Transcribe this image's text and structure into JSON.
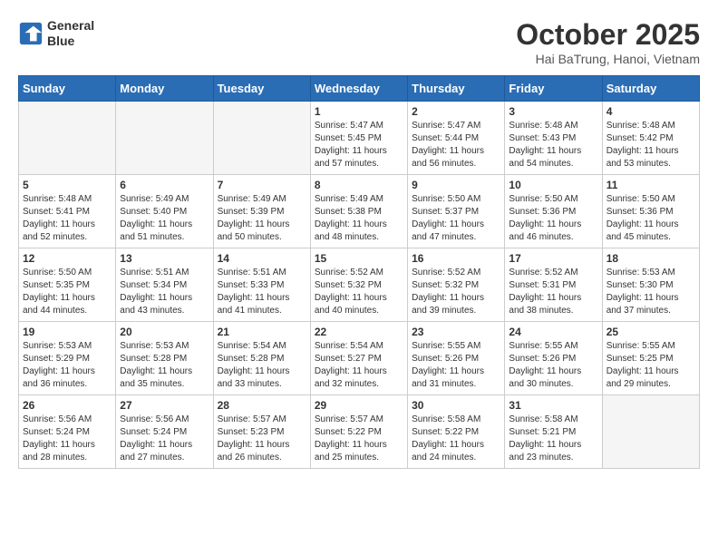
{
  "header": {
    "logo_line1": "General",
    "logo_line2": "Blue",
    "title": "October 2025",
    "subtitle": "Hai BaTrung, Hanoi, Vietnam"
  },
  "calendar": {
    "weekdays": [
      "Sunday",
      "Monday",
      "Tuesday",
      "Wednesday",
      "Thursday",
      "Friday",
      "Saturday"
    ],
    "weeks": [
      [
        {
          "day": "",
          "info": ""
        },
        {
          "day": "",
          "info": ""
        },
        {
          "day": "",
          "info": ""
        },
        {
          "day": "1",
          "info": "Sunrise: 5:47 AM\nSunset: 5:45 PM\nDaylight: 11 hours\nand 57 minutes."
        },
        {
          "day": "2",
          "info": "Sunrise: 5:47 AM\nSunset: 5:44 PM\nDaylight: 11 hours\nand 56 minutes."
        },
        {
          "day": "3",
          "info": "Sunrise: 5:48 AM\nSunset: 5:43 PM\nDaylight: 11 hours\nand 54 minutes."
        },
        {
          "day": "4",
          "info": "Sunrise: 5:48 AM\nSunset: 5:42 PM\nDaylight: 11 hours\nand 53 minutes."
        }
      ],
      [
        {
          "day": "5",
          "info": "Sunrise: 5:48 AM\nSunset: 5:41 PM\nDaylight: 11 hours\nand 52 minutes."
        },
        {
          "day": "6",
          "info": "Sunrise: 5:49 AM\nSunset: 5:40 PM\nDaylight: 11 hours\nand 51 minutes."
        },
        {
          "day": "7",
          "info": "Sunrise: 5:49 AM\nSunset: 5:39 PM\nDaylight: 11 hours\nand 50 minutes."
        },
        {
          "day": "8",
          "info": "Sunrise: 5:49 AM\nSunset: 5:38 PM\nDaylight: 11 hours\nand 48 minutes."
        },
        {
          "day": "9",
          "info": "Sunrise: 5:50 AM\nSunset: 5:37 PM\nDaylight: 11 hours\nand 47 minutes."
        },
        {
          "day": "10",
          "info": "Sunrise: 5:50 AM\nSunset: 5:36 PM\nDaylight: 11 hours\nand 46 minutes."
        },
        {
          "day": "11",
          "info": "Sunrise: 5:50 AM\nSunset: 5:36 PM\nDaylight: 11 hours\nand 45 minutes."
        }
      ],
      [
        {
          "day": "12",
          "info": "Sunrise: 5:50 AM\nSunset: 5:35 PM\nDaylight: 11 hours\nand 44 minutes."
        },
        {
          "day": "13",
          "info": "Sunrise: 5:51 AM\nSunset: 5:34 PM\nDaylight: 11 hours\nand 43 minutes."
        },
        {
          "day": "14",
          "info": "Sunrise: 5:51 AM\nSunset: 5:33 PM\nDaylight: 11 hours\nand 41 minutes."
        },
        {
          "day": "15",
          "info": "Sunrise: 5:52 AM\nSunset: 5:32 PM\nDaylight: 11 hours\nand 40 minutes."
        },
        {
          "day": "16",
          "info": "Sunrise: 5:52 AM\nSunset: 5:32 PM\nDaylight: 11 hours\nand 39 minutes."
        },
        {
          "day": "17",
          "info": "Sunrise: 5:52 AM\nSunset: 5:31 PM\nDaylight: 11 hours\nand 38 minutes."
        },
        {
          "day": "18",
          "info": "Sunrise: 5:53 AM\nSunset: 5:30 PM\nDaylight: 11 hours\nand 37 minutes."
        }
      ],
      [
        {
          "day": "19",
          "info": "Sunrise: 5:53 AM\nSunset: 5:29 PM\nDaylight: 11 hours\nand 36 minutes."
        },
        {
          "day": "20",
          "info": "Sunrise: 5:53 AM\nSunset: 5:28 PM\nDaylight: 11 hours\nand 35 minutes."
        },
        {
          "day": "21",
          "info": "Sunrise: 5:54 AM\nSunset: 5:28 PM\nDaylight: 11 hours\nand 33 minutes."
        },
        {
          "day": "22",
          "info": "Sunrise: 5:54 AM\nSunset: 5:27 PM\nDaylight: 11 hours\nand 32 minutes."
        },
        {
          "day": "23",
          "info": "Sunrise: 5:55 AM\nSunset: 5:26 PM\nDaylight: 11 hours\nand 31 minutes."
        },
        {
          "day": "24",
          "info": "Sunrise: 5:55 AM\nSunset: 5:26 PM\nDaylight: 11 hours\nand 30 minutes."
        },
        {
          "day": "25",
          "info": "Sunrise: 5:55 AM\nSunset: 5:25 PM\nDaylight: 11 hours\nand 29 minutes."
        }
      ],
      [
        {
          "day": "26",
          "info": "Sunrise: 5:56 AM\nSunset: 5:24 PM\nDaylight: 11 hours\nand 28 minutes."
        },
        {
          "day": "27",
          "info": "Sunrise: 5:56 AM\nSunset: 5:24 PM\nDaylight: 11 hours\nand 27 minutes."
        },
        {
          "day": "28",
          "info": "Sunrise: 5:57 AM\nSunset: 5:23 PM\nDaylight: 11 hours\nand 26 minutes."
        },
        {
          "day": "29",
          "info": "Sunrise: 5:57 AM\nSunset: 5:22 PM\nDaylight: 11 hours\nand 25 minutes."
        },
        {
          "day": "30",
          "info": "Sunrise: 5:58 AM\nSunset: 5:22 PM\nDaylight: 11 hours\nand 24 minutes."
        },
        {
          "day": "31",
          "info": "Sunrise: 5:58 AM\nSunset: 5:21 PM\nDaylight: 11 hours\nand 23 minutes."
        },
        {
          "day": "",
          "info": ""
        }
      ]
    ]
  }
}
